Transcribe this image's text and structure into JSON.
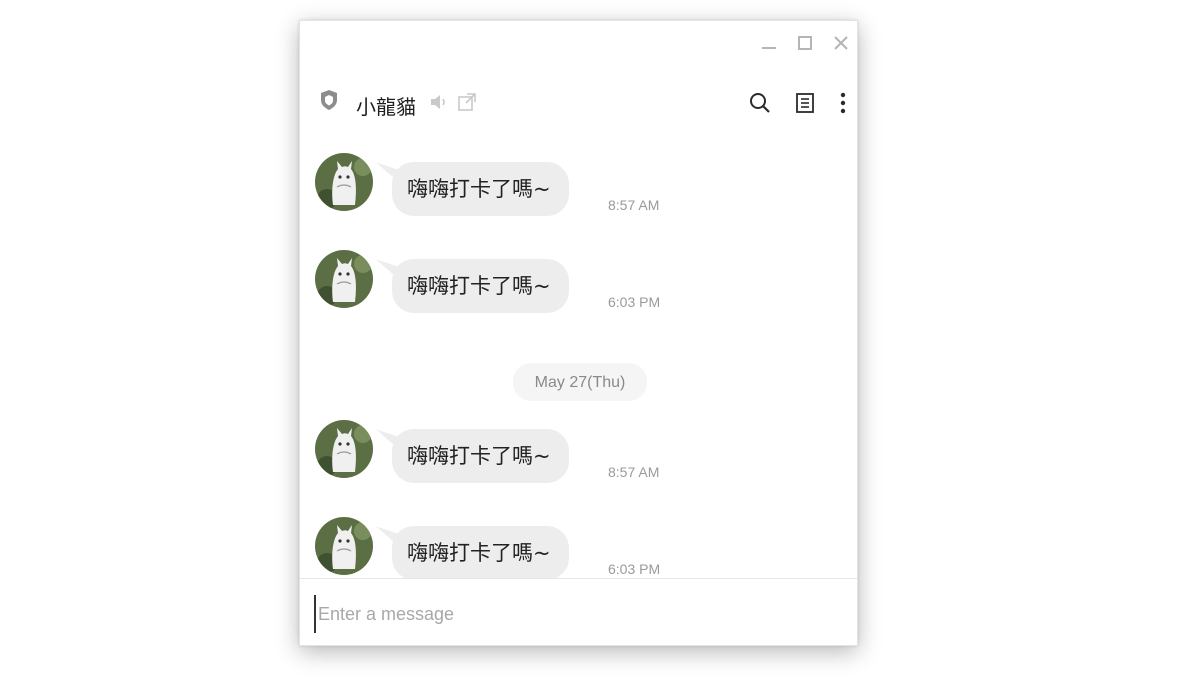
{
  "window": {
    "controls": {
      "minimize_icon": "minimize-icon",
      "maximize_icon": "maximize-icon",
      "close_icon": "close-icon"
    }
  },
  "header": {
    "chat_name": "小龍貓",
    "icons": [
      "shield-icon",
      "mute-icon",
      "popout-icon",
      "search-icon",
      "notes-icon",
      "more-icon"
    ]
  },
  "messages": [
    {
      "text": "嗨嗨打卡了嗎~",
      "time": "8:57 AM"
    },
    {
      "text": "嗨嗨打卡了嗎~",
      "time": "6:03 PM"
    },
    {
      "text": "嗨嗨打卡了嗎~",
      "time": "8:57 AM"
    },
    {
      "text": "嗨嗨打卡了嗎~",
      "time": "6:03 PM"
    }
  ],
  "date_separator": "May 27(Thu)",
  "composer": {
    "placeholder": "Enter a message"
  },
  "colors": {
    "bubble": "#ededed",
    "avatar_bg": "#5b6e44",
    "time": "#9a9a9a"
  }
}
